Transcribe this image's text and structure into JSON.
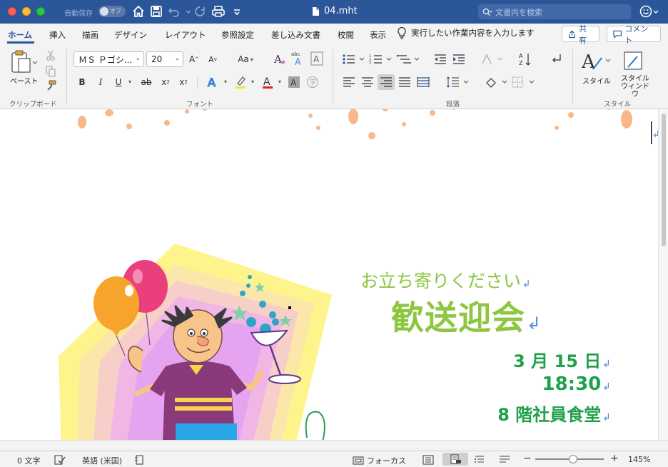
{
  "window": {
    "autosave_label": "自動保存",
    "autosave_state": "オフ",
    "doc_title": "04.mht",
    "search_placeholder": "文書内を検索"
  },
  "tabs": [
    {
      "label": "ホーム",
      "active": true
    },
    {
      "label": "挿入"
    },
    {
      "label": "描画"
    },
    {
      "label": "デザイン"
    },
    {
      "label": "レイアウト"
    },
    {
      "label": "参照設定"
    },
    {
      "label": "差し込み文書"
    },
    {
      "label": "校閲"
    },
    {
      "label": "表示"
    }
  ],
  "tell_me": "実行したい作業内容を入力します",
  "share_label": "共有",
  "comment_label": "コメント",
  "ribbon": {
    "clipboard": {
      "paste_label": "ペースト",
      "group_label": "クリップボード"
    },
    "font": {
      "font_name": "ＭＳ Ｐゴシ...",
      "font_size": "20",
      "group_label": "フォント",
      "bold": "B",
      "italic": "I",
      "underline": "U",
      "strike": "ab",
      "sub": "x",
      "sup": "x",
      "grow": "A",
      "shrink": "A",
      "change_case": "Aa"
    },
    "paragraph": {
      "group_label": "段落"
    },
    "styles": {
      "style_label": "スタイル",
      "pane_label_1": "スタイル",
      "pane_label_2": "ウィンドウ",
      "group_label": "スタイル"
    }
  },
  "flyer": {
    "invite": "お立ち寄りください",
    "main_title": "歓送迎会",
    "date": "3 月 15 日",
    "time": "18:30",
    "place": "8 階社員食堂"
  },
  "statusbar": {
    "word_count": "0 文字",
    "language": "英語 (米国)",
    "focus": "フォーカス",
    "zoom": "145%"
  },
  "colors": {
    "titlebar": "#2b579a",
    "flyer_light_green": "#8dc63f",
    "flyer_dark_green": "#1fa04a",
    "paragraph_mark": "#4a90d9"
  }
}
